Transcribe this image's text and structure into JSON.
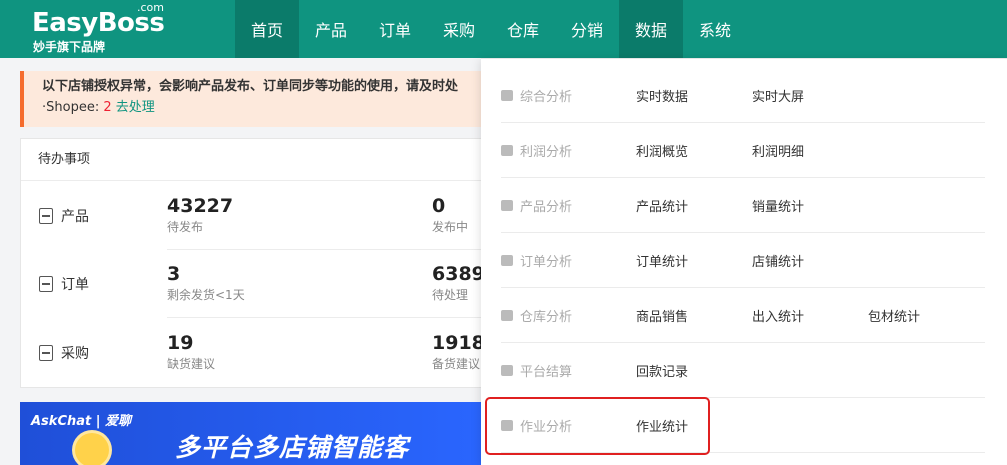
{
  "header": {
    "logo_main": "EasyBoss",
    "logo_com": ".com",
    "logo_sub": "妙手旗下品牌",
    "nav": [
      {
        "label": "首页",
        "active": true
      },
      {
        "label": "产品",
        "active": false
      },
      {
        "label": "订单",
        "active": false
      },
      {
        "label": "采购",
        "active": false
      },
      {
        "label": "仓库",
        "active": false
      },
      {
        "label": "分销",
        "active": false
      },
      {
        "label": "数据",
        "active": true
      },
      {
        "label": "系统",
        "active": false
      }
    ]
  },
  "alert": {
    "title": "以下店铺授权异常，会影响产品发布、订单同步等功能的使用，请及时处",
    "platform": "·Shopee:",
    "count": "2",
    "action": "去处理"
  },
  "todo": {
    "title": "待办事项",
    "rows": [
      {
        "label": "产品",
        "icon": "product-icon",
        "metrics": [
          {
            "value": "43227",
            "label": "待发布"
          },
          {
            "value": "0",
            "label": "发布中"
          }
        ]
      },
      {
        "label": "订单",
        "icon": "order-icon",
        "metrics": [
          {
            "value": "3",
            "label": "剩余发货<1天"
          },
          {
            "value": "6389",
            "label": "待处理"
          }
        ]
      },
      {
        "label": "采购",
        "icon": "purchase-icon",
        "metrics": [
          {
            "value": "19",
            "label": "缺货建议"
          },
          {
            "value": "1918",
            "label": "备货建议"
          }
        ]
      }
    ]
  },
  "banner": {
    "brand": "AskChat | 爱聊",
    "text": "多平台多店铺智能客"
  },
  "dropdown": {
    "rows": [
      {
        "category": "综合分析",
        "icon": "overview-icon",
        "links": [
          "实时数据",
          "实时大屏"
        ]
      },
      {
        "category": "利润分析",
        "icon": "profit-icon",
        "links": [
          "利润概览",
          "利润明细"
        ]
      },
      {
        "category": "产品分析",
        "icon": "product-analysis-icon",
        "links": [
          "产品统计",
          "销量统计"
        ]
      },
      {
        "category": "订单分析",
        "icon": "order-analysis-icon",
        "links": [
          "订单统计",
          "店铺统计"
        ]
      },
      {
        "category": "仓库分析",
        "icon": "warehouse-analysis-icon",
        "links": [
          "商品销售",
          "出入统计",
          "包材统计"
        ]
      },
      {
        "category": "平台结算",
        "icon": "settlement-icon",
        "links": [
          "回款记录"
        ]
      },
      {
        "category": "作业分析",
        "icon": "task-analysis-icon",
        "links": [
          "作业统计"
        ]
      }
    ]
  },
  "colors": {
    "header_bg": "#0f9480",
    "nav_active": "#0b7b6a",
    "link": "#0f9480",
    "alert_border": "#f56c2d",
    "highlight": "#e02020"
  }
}
